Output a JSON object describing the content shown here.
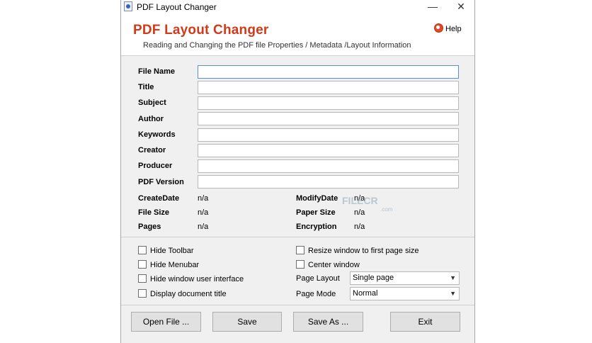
{
  "window": {
    "title": "PDF Layout Changer",
    "minimize": "—",
    "close": "✕"
  },
  "header": {
    "title": "PDF Layout Changer",
    "subtitle": "Reading and Changing the PDF file Properties / Metadata /Layout Information",
    "help_label": "Help"
  },
  "fields": [
    {
      "label": "File Name",
      "value": ""
    },
    {
      "label": "Title",
      "value": ""
    },
    {
      "label": "Subject",
      "value": ""
    },
    {
      "label": "Author",
      "value": ""
    },
    {
      "label": "Keywords",
      "value": ""
    },
    {
      "label": "Creator",
      "value": ""
    },
    {
      "label": "Producer",
      "value": ""
    },
    {
      "label": "PDF Version",
      "value": ""
    }
  ],
  "info": {
    "create_date": {
      "label": "CreateDate",
      "value": "n/a"
    },
    "file_size": {
      "label": "File Size",
      "value": "n/a"
    },
    "pages": {
      "label": "Pages",
      "value": "n/a"
    },
    "modify_date": {
      "label": "ModifyDate",
      "value": "n/a"
    },
    "paper_size": {
      "label": "Paper Size",
      "value": "n/a"
    },
    "encryption": {
      "label": "Encryption",
      "value": "n/a"
    }
  },
  "options": {
    "hide_toolbar": "Hide Toolbar",
    "hide_menubar": "Hide Menubar",
    "hide_window_ui": "Hide window user interface",
    "display_doc_title": "Display document title",
    "resize_window": "Resize window to first page size",
    "center_window": "Center window"
  },
  "page_layout": {
    "label": "Page Layout",
    "selected": "Single page"
  },
  "page_mode": {
    "label": "Page Mode",
    "selected": "Normal"
  },
  "buttons": {
    "open": "Open File ...",
    "save": "Save",
    "save_as": "Save As ...",
    "exit": "Exit"
  },
  "watermark": {
    "brand": "FILECR",
    "suffix": ".com"
  }
}
